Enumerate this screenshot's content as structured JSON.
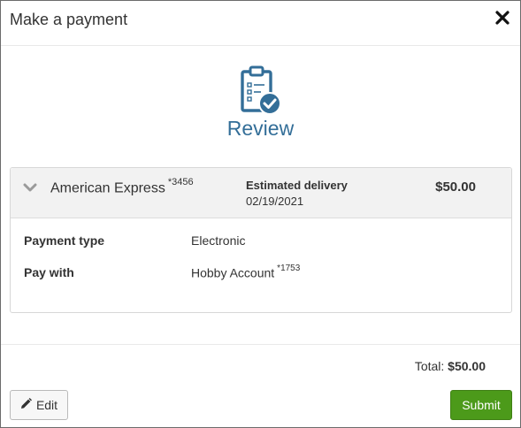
{
  "dialog": {
    "title": "Make a payment",
    "close_icon": "close-icon"
  },
  "review": {
    "icon": "clipboard-check-icon",
    "title": "Review",
    "color": "#336e98"
  },
  "payment": {
    "account_name": "American Express",
    "account_suffix": "*3456",
    "estimated_delivery_label": "Estimated delivery",
    "estimated_delivery_date": "02/19/2021",
    "amount": "$50.00",
    "details": [
      {
        "label": "Payment type",
        "value": "Electronic",
        "suffix": ""
      },
      {
        "label": "Pay with",
        "value": "Hobby Account",
        "suffix": "*1753"
      }
    ]
  },
  "footer": {
    "total_label": "Total:",
    "total_value": "$50.00",
    "edit_label": "Edit",
    "edit_icon": "pencil-icon",
    "submit_label": "Submit",
    "submit_color": "#4c9a1a"
  }
}
